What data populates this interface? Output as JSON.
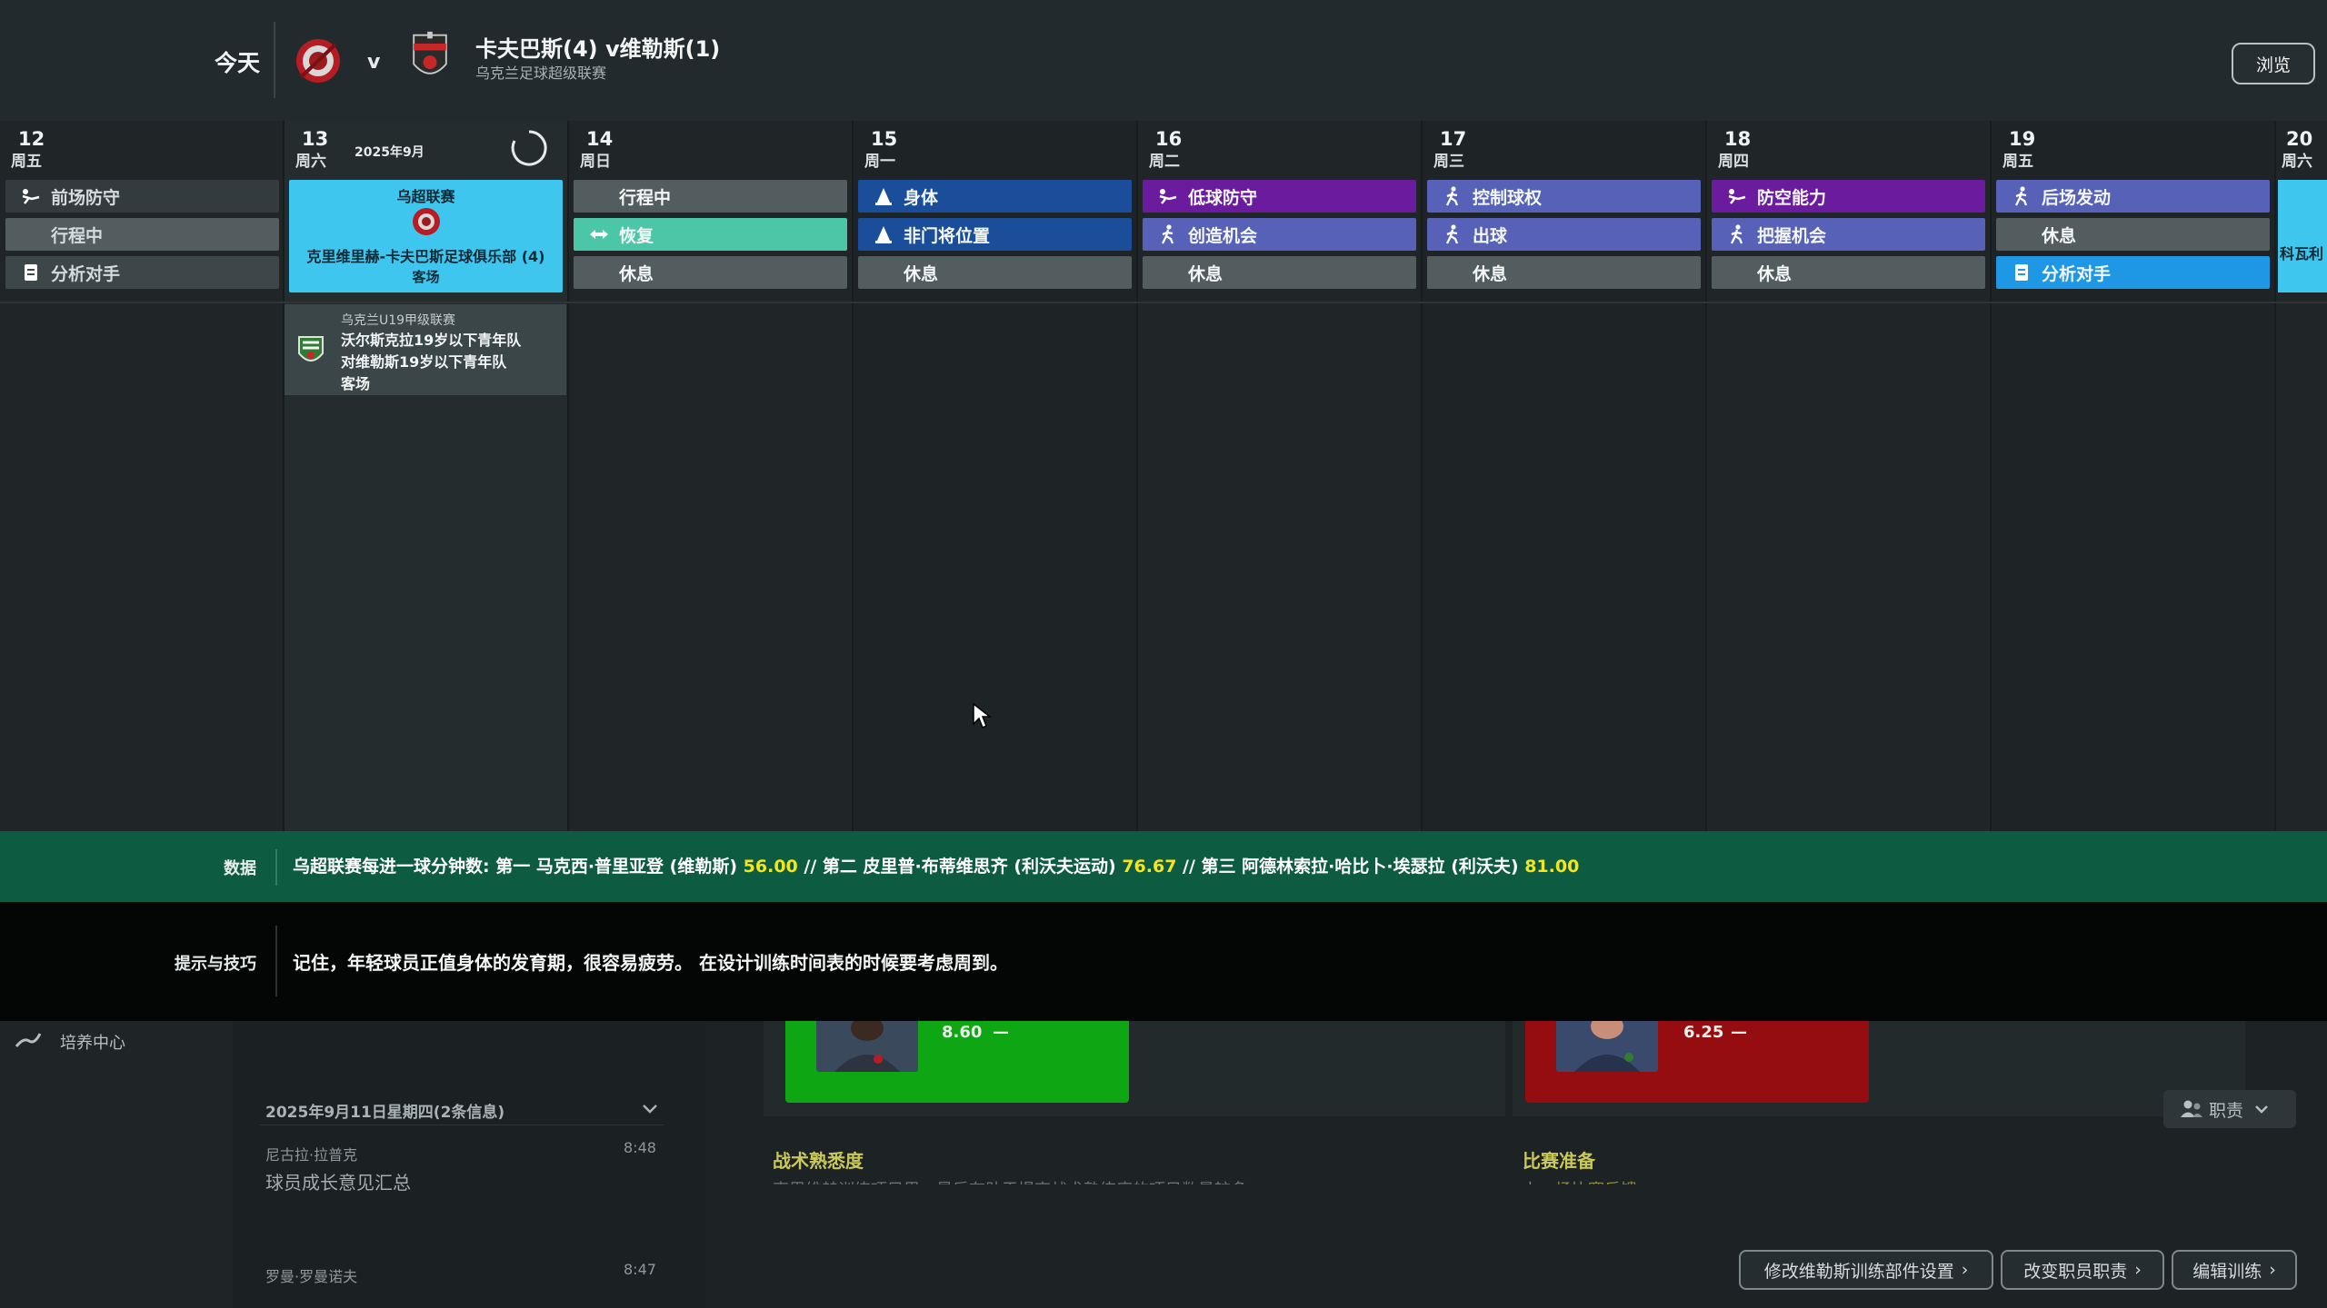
{
  "header": {
    "today_label": "今天",
    "vs": "v",
    "match_title": "卡夫巴斯(4) v维勒斯(1)",
    "competition": "乌克兰足球超级联赛",
    "browse_label": "浏览"
  },
  "calendar": {
    "month_label": "2025年9月",
    "days": [
      {
        "num": "12",
        "dow": "周五"
      },
      {
        "num": "13",
        "dow": "周六"
      },
      {
        "num": "14",
        "dow": "周日"
      },
      {
        "num": "15",
        "dow": "周一"
      },
      {
        "num": "16",
        "dow": "周二"
      },
      {
        "num": "17",
        "dow": "周三"
      },
      {
        "num": "18",
        "dow": "周四"
      },
      {
        "num": "19",
        "dow": "周五"
      },
      {
        "num": "20",
        "dow": "周六"
      }
    ],
    "sessions": {
      "d12": [
        "前场防守",
        "行程中",
        "分析对手"
      ],
      "d14": [
        "行程中",
        "恢复",
        "休息"
      ],
      "d15": [
        "身体",
        "非门将位置",
        "休息"
      ],
      "d16": [
        "低球防守",
        "创造机会",
        "休息"
      ],
      "d17": [
        "控制球权",
        "出球",
        "休息"
      ],
      "d18": [
        "防空能力",
        "把握机会",
        "休息"
      ],
      "d19": [
        "后场发动",
        "休息",
        "分析对手"
      ]
    },
    "match_card": {
      "competition": "乌超联赛",
      "teams": "克里维里赫-卡夫巴斯足球俱乐部 (4)",
      "venue": "客场"
    },
    "youth_card": {
      "competition": "乌克兰U19甲级联赛",
      "line1": "沃尔斯克拉19岁以下青年队",
      "line2": "对维勒斯19岁以下青年队",
      "venue": "客场"
    },
    "edge_card_text": "科瓦利"
  },
  "data_bar": {
    "label": "数据",
    "prefix": "乌超联赛每进一球分钟数: 第一 马克西·普里亚登 (维勒斯) ",
    "v1": "56.00",
    "mid1": " // 第二 皮里普·布蒂维思齐 (利沃夫运动) ",
    "v2": "76.67",
    "mid2": " // 第三 阿德林索拉·哈比卜·埃瑟拉 (利沃夫) ",
    "v3": "81.00"
  },
  "tips_bar": {
    "label": "提示与技巧",
    "text": "记住，年轻球员正值身体的发育期，很容易疲劳。 在设计训练时间表的时候要考虑周到。"
  },
  "bottom": {
    "nav_label": "培养中心",
    "msg_date": "2025年9月11日星期四(2条信息)",
    "messages": [
      {
        "sender": "尼古拉·拉普克",
        "time": "8:48",
        "title": "球员成长意见汇总"
      },
      {
        "sender": "罗曼·罗曼诺夫",
        "time": "8:47",
        "title": ""
      }
    ],
    "rating_a": "8.60",
    "rating_a_trend": "—",
    "rating_b": "6.25",
    "rating_b_trend": "—",
    "section_a_head": "战术熟悉度",
    "section_a_sub": "克里维赫训练项目里，最后有助于提高战术熟练度的项目数量较多",
    "section_b_head": "比赛准备",
    "section_b_sub": "上一场比赛反馈",
    "role_label": "职责",
    "btn_modify": "修改维勒斯训练部件设置",
    "btn_roles": "改变职员职责",
    "btn_edit": "编辑训练"
  },
  "colors": {
    "grey_session": "#535d60",
    "blue_session": "#1a4e9a",
    "purple_session": "#6a1b9e",
    "violet_session": "#5761b8",
    "teal_session": "#4bc7a7",
    "cyan_session": "#1e98e4",
    "match_card": "#3ec6ee",
    "data_bar": "#0d5b40",
    "highlight": "#f5e51c"
  },
  "icons": [
    "defence-icon",
    "physical-icon",
    "recovery-icon",
    "attack-icon",
    "analysis-icon",
    "cursor-icon",
    "spinner-icon",
    "role-icon",
    "chevron-right-icon",
    "chevron-down-icon"
  ]
}
